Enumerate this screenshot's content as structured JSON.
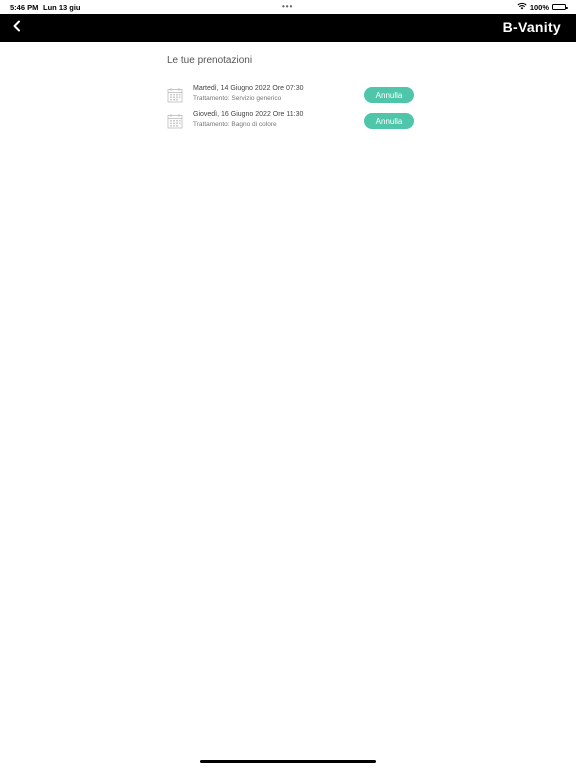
{
  "status_bar": {
    "time": "5:46 PM",
    "date": "Lun 13 giu",
    "dots": "•••",
    "battery_percent": "100%",
    "battery_level": 1.0
  },
  "nav": {
    "back_icon": "chevron-left-icon",
    "title": "B-Vanity"
  },
  "main": {
    "section_title": "Le tue prenotazioni",
    "bookings": [
      {
        "date": "Martedì, 14 Giugno 2022 Ore 07:30",
        "treatment": "Trattamento: Servizio generico",
        "cancel_label": "Annulla",
        "icon": "calendar-icon"
      },
      {
        "date": "Giovedì, 16 Giugno 2022 Ore 11:30",
        "treatment": "Trattamento: Bagno di colore",
        "cancel_label": "Annulla",
        "icon": "calendar-icon"
      }
    ]
  },
  "colors": {
    "accent": "#4fc6a9",
    "nav_bg": "#000000"
  }
}
